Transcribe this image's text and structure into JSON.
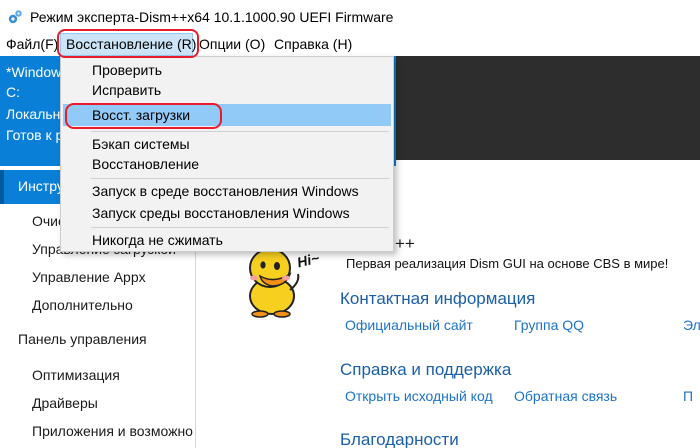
{
  "window": {
    "title": "Режим эксперта-Dism++x64 10.1.1000.90 UEFI Firmware"
  },
  "menubar": {
    "file": "Файл(F)",
    "restore": "Восстановление (R)",
    "options": "Опции (O)",
    "help": "Справка (H)"
  },
  "info_panel": {
    "line1": "*Windows",
    "line2": "C:",
    "line3": "Локальн",
    "line4": "Готов к р"
  },
  "restore_menu": {
    "check": "Проверить",
    "fix": "Исправить",
    "boot_restore": "Восст. загрузки",
    "backup": "Бэкап системы",
    "recovery": "Восстановление",
    "run_in_winre": "Запуск в среде восстановления Windows",
    "run_winre": "Запуск среды восстановления Windows",
    "never_compress": "Никогда не сжимать"
  },
  "sidebar": {
    "tools_group": "Инстру",
    "cleanup": "Очис",
    "boot_manage": "Управление загрузкой",
    "appx": "Управление Appx",
    "additional": "Дополнительно",
    "control_panel": "Панель управления",
    "optimize": "Оптимизация",
    "drivers": "Драйверы",
    "apps_features": "Приложения и возможно"
  },
  "content": {
    "app_name_tail": "++",
    "tagline": "Первая реализация Dism GUI на основе CBS в мире!",
    "contact_heading": "Контактная информация",
    "official_site": "Официальный сайт",
    "qq_group": "Группа QQ",
    "email_partial": "Эл",
    "support_heading": "Справка и поддержка",
    "open_source": "Открыть исходный код",
    "feedback": "Обратная связь",
    "support_partial": "П",
    "thanks_heading": "Благодарности",
    "duck_greeting": "Hi~"
  },
  "colors": {
    "accent_blue": "#0a7fd8",
    "menu_highlight": "#91c9f7",
    "annotation_red": "#e81c2b",
    "link_blue": "#1d73c9",
    "heading_blue": "#1a5fa8"
  }
}
